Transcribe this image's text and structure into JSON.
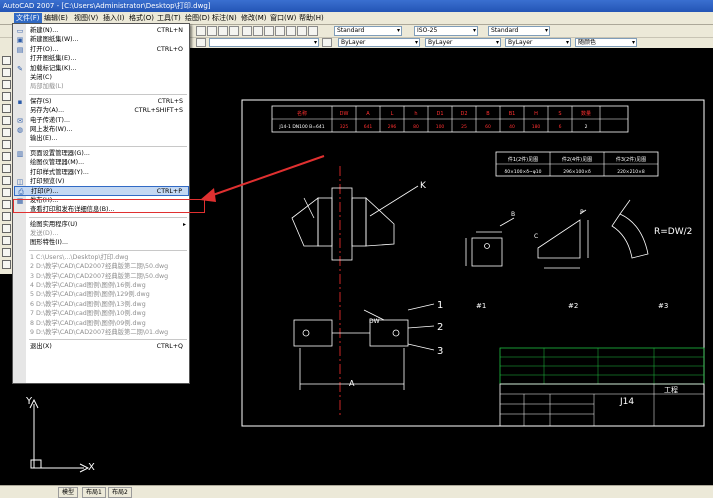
{
  "app": {
    "title": "AutoCAD 2007 - [C:\\Users\\Administrator\\Desktop\\打印.dwg]"
  },
  "menubar": [
    {
      "label": "文件(F)",
      "active": true
    },
    {
      "label": "编辑(E)"
    },
    {
      "label": "视图(V)"
    },
    {
      "label": "插入(I)"
    },
    {
      "label": "格式(O)"
    },
    {
      "label": "工具(T)"
    },
    {
      "label": "绘图(D)"
    },
    {
      "label": "标注(N)"
    },
    {
      "label": "修改(M)"
    },
    {
      "label": "窗口(W)"
    },
    {
      "label": "帮助(H)"
    }
  ],
  "toolbar": {
    "text_style": "Standard",
    "dim_style": "ISO-25",
    "table_style": "Standard",
    "color": "ByLayer",
    "linetype": "ByLayer",
    "lineweight": "ByLayer",
    "plot_style": "随颜色"
  },
  "file_menu": {
    "items": [
      {
        "label": "新建(N)...",
        "shortcut": "CTRL+N",
        "icon": "new-file-icon"
      },
      {
        "label": "新建图纸集(W)...",
        "shortcut": "",
        "icon": "new-sheetset-icon"
      },
      {
        "label": "打开(O)...",
        "shortcut": "CTRL+O",
        "icon": "open-folder-icon"
      },
      {
        "label": "打开图纸集(E)...",
        "shortcut": "",
        "icon": ""
      },
      {
        "label": "加载标记集(K)...",
        "shortcut": "",
        "icon": "markup-icon"
      },
      {
        "label": "关闭(C)",
        "shortcut": "",
        "icon": ""
      },
      {
        "label": "局部加载(L)",
        "shortcut": "",
        "icon": "",
        "disabled": true
      },
      {
        "separator": true
      },
      {
        "label": "保存(S)",
        "shortcut": "CTRL+S",
        "icon": "save-icon"
      },
      {
        "label": "另存为(A)...",
        "shortcut": "CTRL+SHIFT+S",
        "icon": ""
      },
      {
        "label": "电子传递(T)...",
        "shortcut": "",
        "icon": "etransmit-icon"
      },
      {
        "label": "网上发布(W)...",
        "shortcut": "",
        "icon": "publish-web-icon"
      },
      {
        "label": "输出(E)...",
        "shortcut": "",
        "icon": ""
      },
      {
        "separator": true
      },
      {
        "label": "页面设置管理器(G)...",
        "shortcut": "",
        "icon": "page-setup-icon"
      },
      {
        "label": "绘图仪管理器(M)...",
        "shortcut": "",
        "icon": ""
      },
      {
        "label": "打印样式管理器(Y)...",
        "shortcut": "",
        "icon": ""
      },
      {
        "label": "打印预览(V)",
        "shortcut": "",
        "icon": "print-preview-icon"
      },
      {
        "label": "打印(P)...",
        "shortcut": "CTRL+P",
        "icon": "print-icon",
        "highlighted": true
      },
      {
        "label": "发布(H)...",
        "shortcut": "",
        "icon": "publish-icon"
      },
      {
        "label": "查看打印和发布详细信息(B)...",
        "shortcut": "",
        "icon": ""
      },
      {
        "separator": true
      },
      {
        "label": "绘图实用程序(U)",
        "shortcut": "",
        "icon": "",
        "submenu": true
      },
      {
        "label": "发送(D)...",
        "shortcut": "",
        "icon": "",
        "disabled": true
      },
      {
        "label": "图形特性(I)...",
        "shortcut": "",
        "icon": ""
      },
      {
        "separator": true
      },
      {
        "label": "1 C:\\Users\\...\\Desktop\\打印.dwg",
        "shortcut": "",
        "icon": "",
        "disabled": true
      },
      {
        "label": "2 D:\\教学\\CAD\\CAD2007经典版第二期\\50.dwg",
        "shortcut": "",
        "icon": "",
        "disabled": true
      },
      {
        "label": "3 D:\\教学\\CAD\\CAD2007经典版第二期\\50.dwg",
        "shortcut": "",
        "icon": "",
        "disabled": true
      },
      {
        "label": "4 D:\\教学\\CAD\\cad图例\\图例\\16例.dwg",
        "shortcut": "",
        "icon": "",
        "disabled": true
      },
      {
        "label": "5 D:\\教学\\CAD\\cad图例\\图例\\129例.dwg",
        "shortcut": "",
        "icon": "",
        "disabled": true
      },
      {
        "label": "6 D:\\教学\\CAD\\cad图例\\图例\\13例.dwg",
        "shortcut": "",
        "icon": "",
        "disabled": true
      },
      {
        "label": "7 D:\\教学\\CAD\\cad图例\\图例\\10例.dwg",
        "shortcut": "",
        "icon": "",
        "disabled": true
      },
      {
        "label": "8 D:\\教学\\CAD\\cad图例\\图例\\09例.dwg",
        "shortcut": "",
        "icon": "",
        "disabled": true
      },
      {
        "label": "9 D:\\教学\\CAD\\CAD2007经典版第二期\\01.dwg",
        "shortcut": "",
        "icon": "",
        "disabled": true
      },
      {
        "separator": true
      },
      {
        "label": "退出(X)",
        "shortcut": "CTRL+Q",
        "icon": ""
      }
    ]
  },
  "drawing": {
    "top_table_headers": [
      "名称",
      "DW",
      "A",
      "L",
      "h",
      "D1",
      "D2",
      "B",
      "B1",
      "H",
      "S",
      "数量"
    ],
    "top_table_row": [
      "J14-1 DN100 B=641",
      "325",
      "641",
      "296",
      "80",
      "100",
      "25",
      "60",
      "40",
      "180",
      "6",
      "2"
    ],
    "part_table_headers": [
      "件1(2件)见图",
      "件2(4件)见图",
      "件3(2件)见图"
    ],
    "part_table_values": [
      "δ0×100×δ~φ10",
      "296×100×δ",
      "220×210×8"
    ],
    "labels": {
      "k": "K",
      "r_dw": "R=DW/2",
      "dim_a": "A",
      "dw": "DW",
      "b": "B",
      "leader1": "1",
      "leader2": "2",
      "leader3": "3",
      "c": "C",
      "p": "P",
      "part1": "#1",
      "part2": "#2",
      "part3": "#3",
      "title_block_code": "J14",
      "title_block_name": "工程",
      "axis_y": "Y",
      "axis_x": "X"
    }
  },
  "status_tabs": [
    "模型",
    "布局1",
    "布局2"
  ],
  "colors": {
    "menu_highlight": "#c4d8f2",
    "arrow": "#e03030",
    "drawing_lines": "#ffffff",
    "table_text": "#ff3030",
    "centerline": "#ff3030",
    "title_block_green": "#20c040"
  }
}
